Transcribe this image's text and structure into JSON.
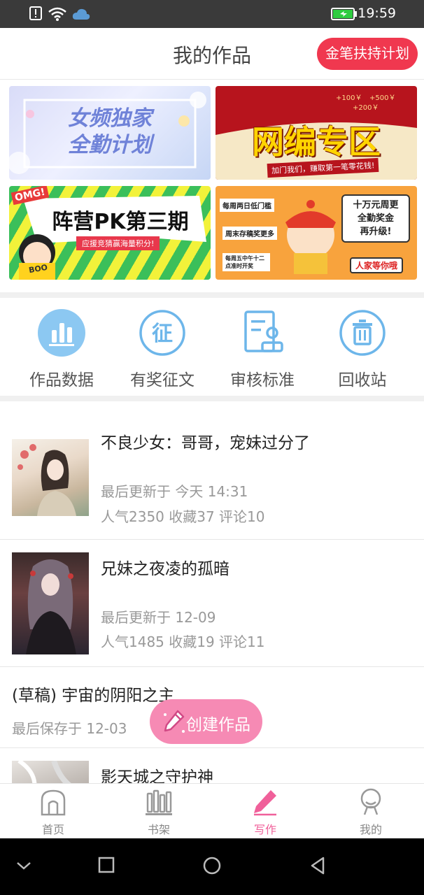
{
  "status_bar": {
    "time": "19:59",
    "icons": [
      "alert-icon",
      "wifi-icon",
      "cloud-icon",
      "battery-icon"
    ]
  },
  "header": {
    "title": "我的作品",
    "plan_button": "金笔扶持计划"
  },
  "banners": [
    {
      "name": "banner-female-exclusive",
      "text": "女频独家\n全勤计划"
    },
    {
      "name": "banner-web-editor",
      "text": "网编专区",
      "sub": "加门我们，赚取第一笔零花钱!",
      "bonus": [
        "+100￥",
        "+500￥",
        "+200￥"
      ]
    },
    {
      "name": "banner-camp-pk",
      "text": "阵营PK第三期",
      "sub": "应援竞猜赢海量积分!",
      "badge": "OMG!",
      "badge2": "BOO"
    },
    {
      "name": "banner-weekly-reward",
      "lines": [
        "每周两日低门槛",
        "周末存稿奖更多",
        "每周五中午十二点准时开奖"
      ],
      "right": [
        "十万元周更",
        "全勤奖金",
        "再升级!"
      ],
      "bottom": "人家等你哦"
    }
  ],
  "quick_entries": [
    {
      "label": "作品数据",
      "icon": "bar-chart-icon"
    },
    {
      "label": "有奖征文",
      "icon": "contest-icon"
    },
    {
      "label": "审核标准",
      "icon": "review-standard-icon"
    },
    {
      "label": "回收站",
      "icon": "trash-icon"
    }
  ],
  "works": [
    {
      "title": "不良少女：哥哥，宠妹过分了",
      "update": "最后更新于 今天 14:31",
      "stats": "人气2350 收藏37 评论10",
      "has_cover": true
    },
    {
      "title": "兄妹之夜凌的孤暗",
      "update": "最后更新于 12-09",
      "stats": "人气1485 收藏19 评论11",
      "has_cover": true
    },
    {
      "title": "(草稿) 宇宙的阴阳之主",
      "update": "最后保存于 12-03",
      "has_cover": false
    },
    {
      "title": "影天城之守护神",
      "has_cover": true
    }
  ],
  "fab": {
    "label": "创建作品",
    "icon": "pencil-icon"
  },
  "tabs": [
    {
      "label": "首页",
      "icon": "home-icon",
      "active": false
    },
    {
      "label": "书架",
      "icon": "bookshelf-icon",
      "active": false
    },
    {
      "label": "写作",
      "icon": "pen-icon",
      "active": true
    },
    {
      "label": "我的",
      "icon": "profile-icon",
      "active": false
    }
  ],
  "colors": {
    "accent": "#f0609a",
    "plan_button": "#f0384f",
    "fab": "#f68ab4",
    "icon_blue": "#5ab0e8"
  }
}
